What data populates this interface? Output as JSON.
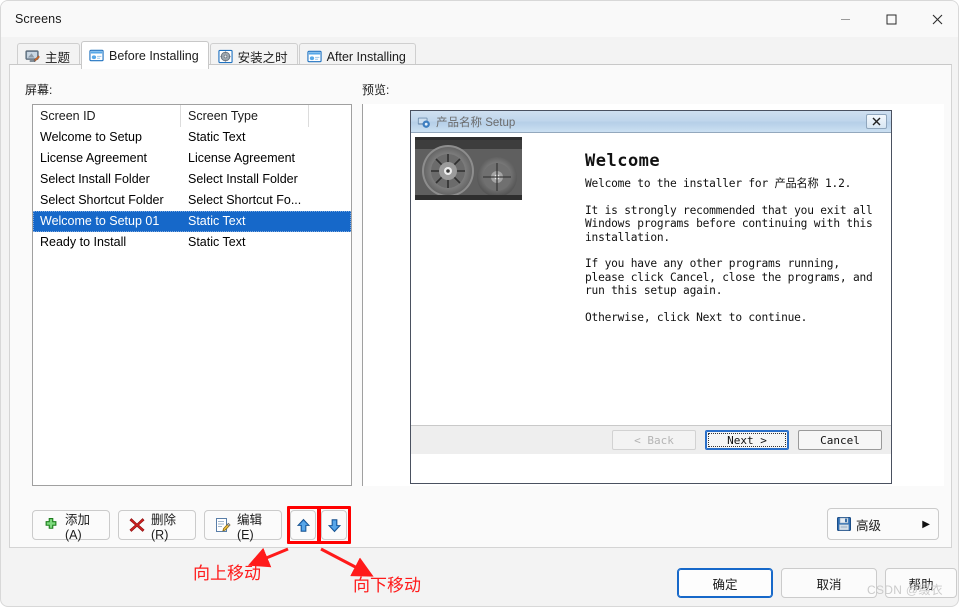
{
  "window": {
    "title": "Screens",
    "controls": {
      "minimize": "minimize-icon",
      "maximize": "maximize-icon",
      "close": "close-icon"
    }
  },
  "tabs": [
    {
      "label": "主题",
      "icon": "theme-monitor-icon",
      "active": false
    },
    {
      "label": "Before Installing",
      "icon": "window-screen-icon",
      "active": true
    },
    {
      "label": "安装之时",
      "icon": "disc-gear-icon",
      "active": false
    },
    {
      "label": "After Installing",
      "icon": "window-screen-icon",
      "active": false
    }
  ],
  "labels": {
    "screens": "屏幕:",
    "preview": "预览:"
  },
  "screens_list": {
    "columns": [
      "Screen ID",
      "Screen Type",
      ""
    ],
    "rows": [
      {
        "id": "Welcome to Setup",
        "type": "Static Text",
        "selected": false
      },
      {
        "id": "License Agreement",
        "type": "License Agreement",
        "selected": false
      },
      {
        "id": "Select Install Folder",
        "type": "Select Install Folder",
        "selected": false
      },
      {
        "id": "Select Shortcut Folder",
        "type": "Select Shortcut Fo...",
        "selected": false
      },
      {
        "id": "Welcome to Setup 01",
        "type": "Static Text",
        "selected": true
      },
      {
        "id": "Ready to Install",
        "type": "Static Text",
        "selected": false
      }
    ]
  },
  "preview": {
    "setup_dialog": {
      "title": "产品名称 Setup",
      "title_icon": "installer-icon",
      "close_label": "✕",
      "image": "gears-photo",
      "heading": "Welcome",
      "paragraphs": [
        "Welcome to the installer for 产品名称 1.2.",
        "It is strongly recommended that you exit all Windows programs before continuing with this installation.",
        "If you have any other programs running, please click Cancel, close the programs, and run this setup again.",
        "Otherwise, click Next to continue."
      ],
      "buttons": [
        {
          "label": "< Back",
          "state": "disabled"
        },
        {
          "label": "Next >",
          "state": "focused"
        },
        {
          "label": "Cancel",
          "state": "normal"
        }
      ]
    }
  },
  "toolbar": {
    "add": {
      "label": "添加(A)",
      "icon": "green-plus-icon"
    },
    "delete": {
      "label": "删除(R)",
      "icon": "red-x-icon"
    },
    "edit": {
      "label": "编辑(E)",
      "icon": "pencil-edit-icon"
    },
    "move_up": {
      "icon": "blue-up-arrow-icon"
    },
    "move_down": {
      "icon": "blue-down-arrow-icon"
    },
    "advanced": {
      "label": "高级",
      "icon": "save-floppy-icon",
      "caret": "▶"
    }
  },
  "footer": {
    "ok": "确定",
    "cancel": "取消",
    "help": "帮助",
    "watermark": "CSDN @缀衣"
  },
  "annotations": {
    "move_up_text": "向上移动",
    "move_down_text": "向下移动",
    "highlight_color": "#ff0000"
  },
  "colors": {
    "selection": "#1668c9",
    "accent": "#1668c9",
    "annotation_red": "#ff1a1a",
    "window_bg": "#f3f3f3",
    "panel_bg": "#fafafa"
  }
}
